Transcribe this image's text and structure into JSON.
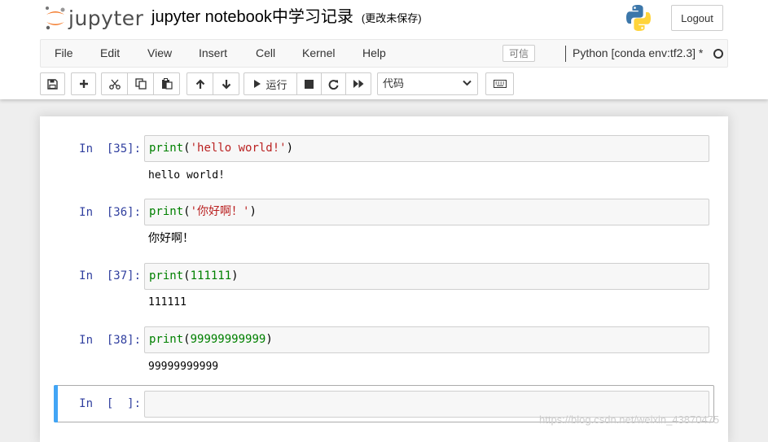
{
  "header": {
    "logo_text": "jupyter",
    "notebook_name": "jupyter notebook中学习记录",
    "save_status": "(更改未保存)",
    "logout_label": "Logout"
  },
  "menubar": {
    "items": [
      "File",
      "Edit",
      "View",
      "Insert",
      "Cell",
      "Kernel",
      "Help"
    ],
    "trusted_label": "可信",
    "kernel_name": "Python [conda env:tf2.3] *",
    "kernel_status": "idle"
  },
  "toolbar": {
    "run_label": "运行",
    "cell_type": "代码",
    "buttons": [
      "save-icon",
      "plus-icon",
      "cut-icon",
      "copy-icon",
      "paste-icon",
      "arrow-up-icon",
      "arrow-down-icon",
      "run-icon",
      "stop-icon",
      "restart-icon",
      "fast-forward-icon",
      "keyboard-icon"
    ]
  },
  "cells": [
    {
      "prompt": "In  [35]:",
      "code": {
        "fn": "print",
        "open": "(",
        "arg": "'hello world!'",
        "arg_type": "string",
        "close": ")"
      },
      "output": "hello world!"
    },
    {
      "prompt": "In  [36]:",
      "code": {
        "fn": "print",
        "open": "(",
        "arg": "'你好啊！'",
        "arg_type": "string",
        "close": ")"
      },
      "output": "你好啊！"
    },
    {
      "prompt": "In  [37]:",
      "code": {
        "fn": "print",
        "open": "(",
        "arg": "111111",
        "arg_type": "number",
        "close": ")"
      },
      "output": "111111"
    },
    {
      "prompt": "In  [38]:",
      "code": {
        "fn": "print",
        "open": "(",
        "arg": "99999999999",
        "arg_type": "number",
        "close": ")"
      },
      "output": "99999999999"
    }
  ],
  "active_cell": {
    "prompt": "In  [  ]:",
    "code": ""
  },
  "watermark": "https://blog.csdn.net/weixin_43870475",
  "colors": {
    "prompt": "#303f9f",
    "keyword": "#008000",
    "string": "#ba2121",
    "number": "#008000",
    "selected_bar": "#42a5f5",
    "logo_orange": "#f37726"
  }
}
